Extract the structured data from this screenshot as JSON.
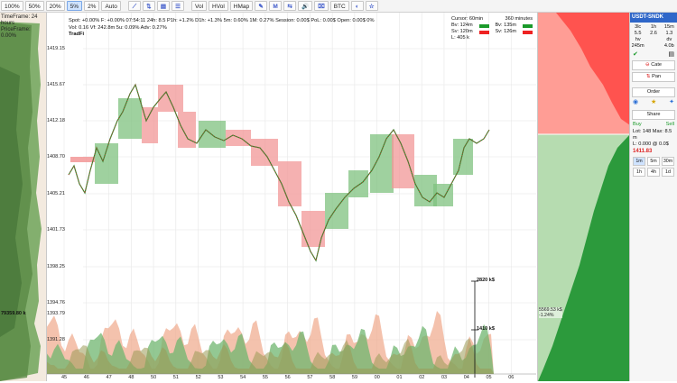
{
  "toolbar": {
    "items": [
      "100%",
      "50%",
      "20%",
      "5%",
      "2%",
      "Auto",
      "⟋",
      "⇅",
      "▤",
      "☰",
      "Vol",
      "HVol",
      "HMap",
      "✎",
      "M",
      "⇆",
      "🔊",
      "⌧",
      "BTC",
      "◐",
      "☆"
    ],
    "active_index": 3
  },
  "left_profile": {
    "timeframe": "TimeFrame: 24 hours",
    "priceframe": "PriceFrame: 0.00%",
    "price_label": "79359.80 k"
  },
  "info": {
    "line1": "Spot: +0.00%   F: +0.00% 07:54:11   24h: 8.5   P1h: +1.2%   D1h: +1.3%   5m: 0.60%   1M: 0.27%   Session: 0.00$   PoL: 0.00$   Open: 0.00$   0%",
    "line2": "Vol: 0.16 Vf: 242.8m   5u: 0.09%   Adv: 0.27%",
    "line3": "TradFi"
  },
  "cursor_box": {
    "col1_title": "Cursor: 60min",
    "col2_title": "360 minutes",
    "rows": [
      {
        "a": "Bv: 124m",
        "b": "Bv: 135m"
      },
      {
        "a": "Sv: 120m",
        "b": "Sv: 126m"
      },
      {
        "a": "L: 405 k",
        "b": ""
      }
    ]
  },
  "y_ticks": [
    "1419.15",
    "1415.67",
    "1412.18",
    "1408.70",
    "1405.21",
    "1401.73",
    "1398.25",
    "1394.76",
    "1393.79",
    "1391.28"
  ],
  "x_ticks": [
    "45",
    "46",
    "47",
    "48",
    "50",
    "51",
    "52",
    "53",
    "54",
    "55",
    "56",
    "57",
    "58",
    "59",
    "00",
    "01",
    "02",
    "03",
    "04",
    "05",
    "06"
  ],
  "volume_labels": {
    "top": "2820 k$",
    "mid": "1410 k$"
  },
  "right_profile": {
    "price": "5569.53 k$",
    "percent": "-1.24%"
  },
  "sidebar": {
    "symbol": "USDT-SNDK",
    "timeframes": [
      "3lc",
      "1h",
      "15m"
    ],
    "values_row1": [
      "5.5",
      "2.6",
      "1.3"
    ],
    "values_row2": [
      "hv 245m",
      "",
      "dv 4.0b"
    ],
    "cate_label": "Cate",
    "pan_label": "Pan",
    "order_label": "Order",
    "share_label": "Share",
    "buy_label": "Buy",
    "sell_label": "Sell",
    "lot_label": "Lot: 148",
    "max_label": "Max: 8.5 m",
    "l_value": "L: 0.000 @ 0.0$",
    "price": "1411.83",
    "tf_buttons": [
      "1m",
      "5m",
      "30m",
      "1h",
      "4h",
      "1d"
    ]
  },
  "colors": {
    "green": "#2f9c3e",
    "red": "#e8474d",
    "accent": "#2f67c9"
  }
}
